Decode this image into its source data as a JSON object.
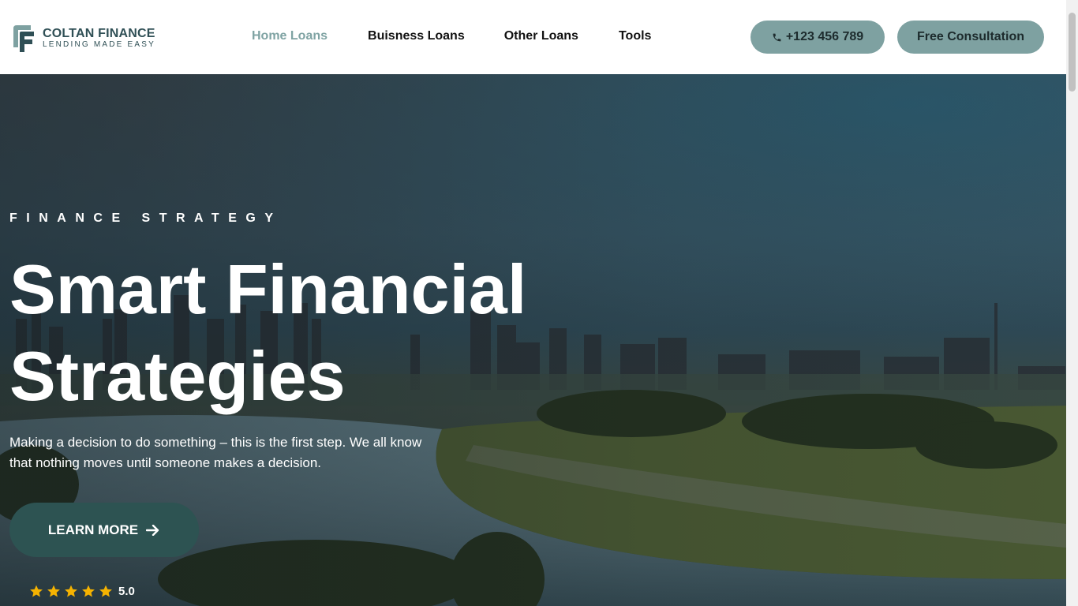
{
  "brand": {
    "name": "COLTAN FINANCE",
    "tagline": "LENDING MADE EASY"
  },
  "nav": {
    "items": [
      {
        "label": "Home Loans",
        "active": true
      },
      {
        "label": "Buisness Loans",
        "active": false
      },
      {
        "label": "Other Loans",
        "active": false
      },
      {
        "label": "Tools",
        "active": false
      }
    ]
  },
  "header_actions": {
    "phone_label": "+123 456 789",
    "consult_label": "Free Consultation"
  },
  "hero": {
    "eyebrow": "FINANCE STRATEGY",
    "headline": "Smart Financial Strategies",
    "lead": "Making a decision to do something – this is the first step. We all know that nothing moves until someone makes a decision.",
    "cta_label": "LEARN MORE",
    "rating_value": "5.0",
    "rating_stars": 5
  },
  "colors": {
    "accent": "#7ea1a1",
    "cta": "#2d5352",
    "star": "#f5b301",
    "brand_text": "#2f4f55"
  },
  "icons": [
    "logo-mark-icon",
    "phone-icon",
    "arrow-right-icon",
    "star-icon"
  ]
}
